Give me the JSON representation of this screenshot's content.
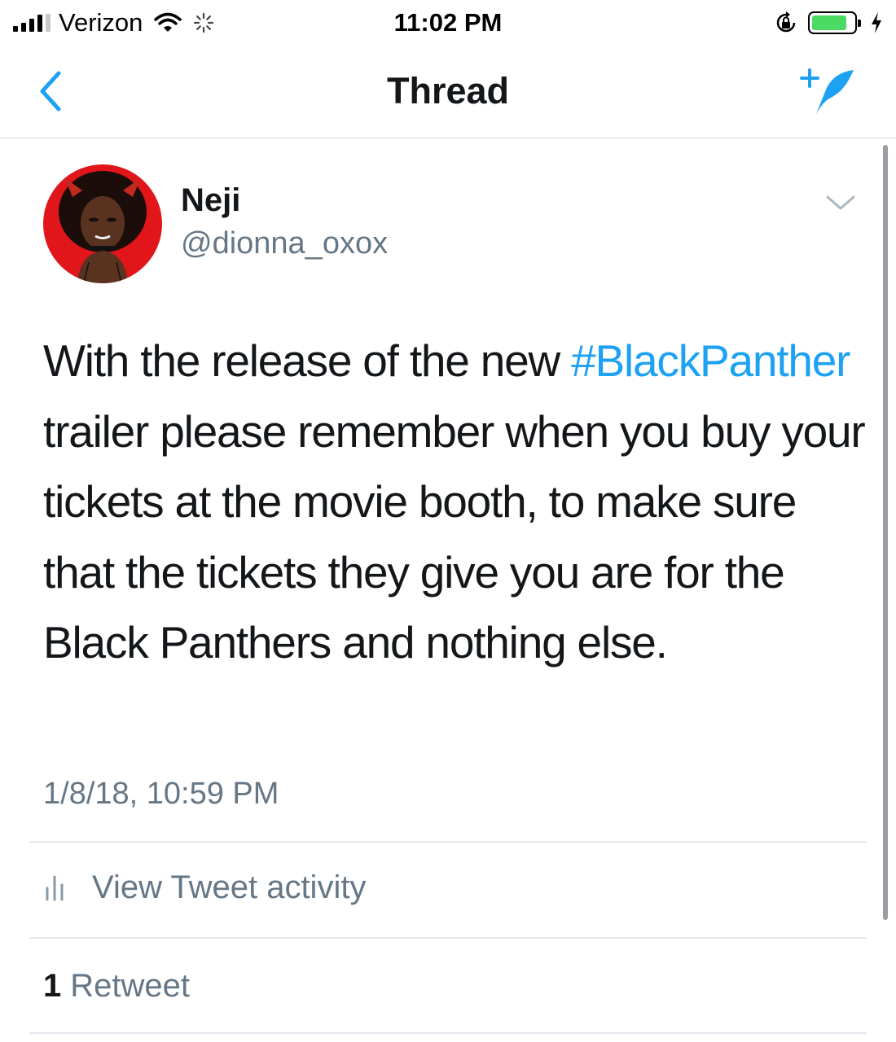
{
  "status_bar": {
    "carrier": "Verizon",
    "time": "11:02 PM",
    "battery_level": 0.85,
    "icons": [
      "signal-icon",
      "wifi-icon",
      "activity-spinner-icon",
      "rotation-lock-icon",
      "battery-icon",
      "charging-bolt-icon"
    ]
  },
  "nav": {
    "title": "Thread",
    "back_icon": "chevron-left-icon",
    "compose_icon": "compose-tweet-icon"
  },
  "tweet": {
    "author_name": "Neji",
    "author_handle": "@dionna_oxox",
    "text_before": "With the release of the new ",
    "hashtag": "#BlackPanther",
    "text_after": " trailer please remember when you buy your tickets at the movie booth, to make sure that the tickets they give you are for the Black Panthers and nothing else.",
    "timestamp": "1/8/18, 10:59 PM",
    "view_activity": "View Tweet activity",
    "retweet_count": "1",
    "retweet_label": "Retweet"
  },
  "colors": {
    "accent": "#1da1f2",
    "secondary_text": "#657786",
    "primary_text": "#14171a",
    "divider": "#e1e8ed",
    "battery": "#4cd964",
    "avatar_background": "#e0161b"
  }
}
